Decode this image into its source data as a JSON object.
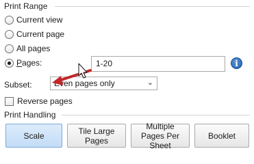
{
  "print_range": {
    "title": "Print Range",
    "options": [
      {
        "label": "Current view",
        "checked": false
      },
      {
        "label": "Current page",
        "checked": false
      },
      {
        "label": "All pages",
        "checked": false
      },
      {
        "label": "Pages:",
        "checked": true
      }
    ],
    "pages_value": "1-20",
    "info_icon": "info-icon",
    "subset_label": "Subset:",
    "subset_value": "Even pages only",
    "reverse_label": "Reverse pages",
    "reverse_checked": false
  },
  "print_handling": {
    "title": "Print Handling",
    "buttons": [
      {
        "label": "Scale",
        "active": true
      },
      {
        "label": "Tile Large Pages",
        "active": false
      },
      {
        "label": "Multiple Pages Per Sheet",
        "active": false
      },
      {
        "label": "Booklet",
        "active": false
      }
    ]
  },
  "annotation": {
    "arrow_color": "#c0282a",
    "cursor": "mouse-pointer-icon"
  }
}
